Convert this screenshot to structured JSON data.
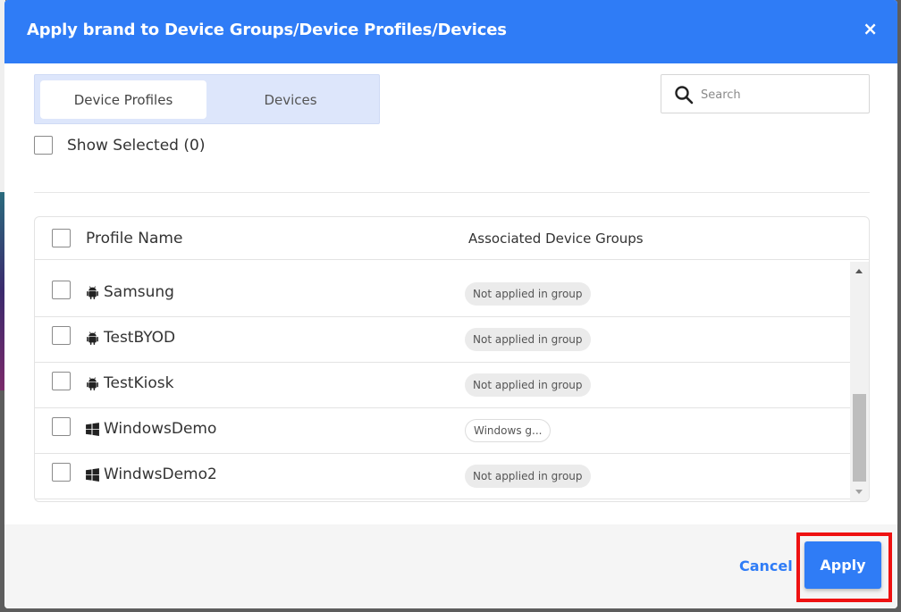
{
  "dialog": {
    "title": "Apply brand to Device Groups/Device Profiles/Devices",
    "close_label": "×"
  },
  "tabs": [
    {
      "label": "Device Profiles",
      "active": true
    },
    {
      "label": "Devices",
      "active": false
    }
  ],
  "search": {
    "placeholder": "Search",
    "value": ""
  },
  "show_selected": {
    "label": "Show Selected (0)",
    "checked": false
  },
  "table": {
    "columns": [
      "Profile Name",
      "Associated Device Groups"
    ],
    "rows": [
      {
        "name": "Samsung",
        "os_icon": "android-icon",
        "group": "Not applied in group"
      },
      {
        "name": "TestBYOD",
        "os_icon": "android-icon",
        "group": "Not applied in group"
      },
      {
        "name": "TestKiosk",
        "os_icon": "android-icon",
        "group": "Not applied in group"
      },
      {
        "name": "WindowsDemo",
        "os_icon": "windows-icon",
        "group": "Windows g..."
      },
      {
        "name": "WindwsDemo2",
        "os_icon": "windows-icon",
        "group": "Not applied in group"
      }
    ]
  },
  "footer": {
    "cancel_label": "Cancel",
    "apply_label": "Apply"
  },
  "colors": {
    "primary": "#2f7cf6",
    "highlight": "#ee1111"
  }
}
